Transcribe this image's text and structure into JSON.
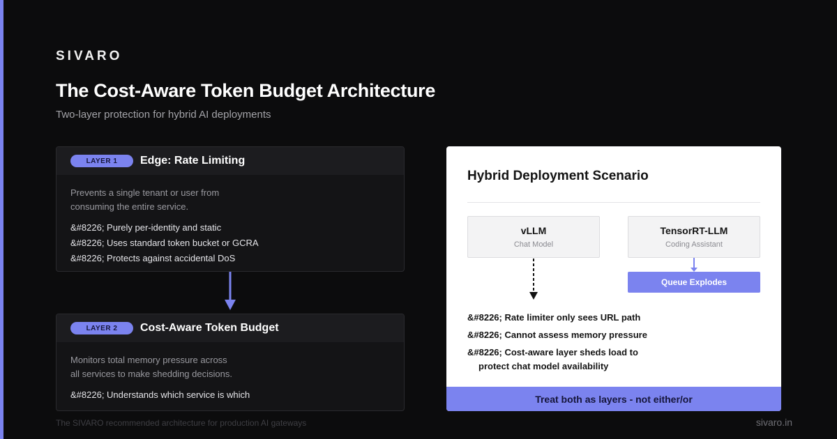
{
  "brand": "SIVARO",
  "title": "The Cost-Aware Token Budget Architecture",
  "subtitle": "Two-layer protection for hybrid AI deployments",
  "colors": {
    "accent": "#7b83ef",
    "background": "#0c0c0d",
    "panel": "#ffffff"
  },
  "layer1": {
    "badge": "LAYER 1",
    "name": "Edge: Rate Limiting",
    "desc": "Prevents a single tenant or user from consuming the entire service.",
    "bullets": [
      "&#8226; Purely per-identity and static",
      "&#8226; Uses standard token bucket or GCRA",
      "&#8226; Protects against accidental DoS"
    ]
  },
  "layer2": {
    "badge": "LAYER 2",
    "name": "Cost-Aware Token Budget",
    "desc": "Monitors total memory pressure across all services to make shedding decisions.",
    "bullets": [
      "&#8226; Understands which service is which"
    ]
  },
  "scenario": {
    "title": "Hybrid Deployment Scenario",
    "services": [
      {
        "name": "vLLM",
        "role": "Chat Model"
      },
      {
        "name": "TensorRT-LLM",
        "role": "Coding Assistant"
      }
    ],
    "queue_label": "Queue Explodes",
    "bullets": [
      "&#8226; Rate limiter only sees URL path",
      "&#8226; Cannot assess memory pressure",
      "&#8226; Cost-aware layer sheds load to"
    ],
    "bullet_continuation": "protect chat model availability",
    "footer": "Treat both as layers - not either/or"
  },
  "footnote": "The SIVARO recommended architecture for production AI gateways",
  "site": "sivaro.in"
}
